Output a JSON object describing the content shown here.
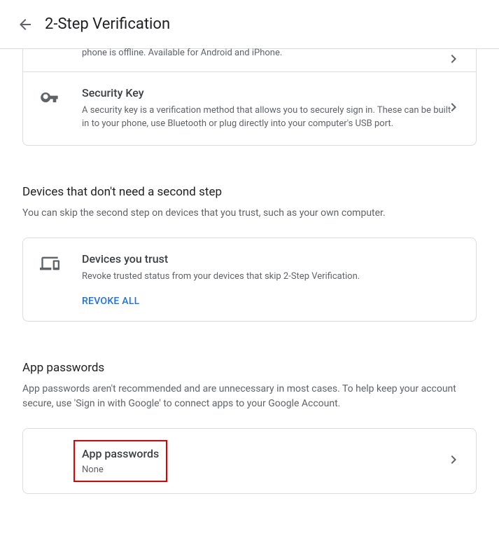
{
  "header": {
    "title": "2-Step Verification"
  },
  "authenticator": {
    "desc_fragment": "phone is offline. Available for Android and iPhone."
  },
  "security_key": {
    "title": "Security Key",
    "desc": "A security key is a verification method that allows you to securely sign in. These can be built in to your phone, use Bluetooth or plug directly into your computer's USB port."
  },
  "devices_section": {
    "title": "Devices that don't need a second step",
    "desc": "You can skip the second step on devices that you trust, such as your own computer."
  },
  "devices_trust": {
    "title": "Devices you trust",
    "desc": "Revoke trusted status from your devices that skip 2-Step Verification.",
    "revoke": "REVOKE ALL"
  },
  "app_pwd_section": {
    "title": "App passwords",
    "desc": "App passwords aren't recommended and are unnecessary in most cases. To help keep your account secure, use 'Sign in with Google' to connect apps to your Google Account."
  },
  "app_pwd": {
    "title": "App passwords",
    "sub": "None"
  }
}
